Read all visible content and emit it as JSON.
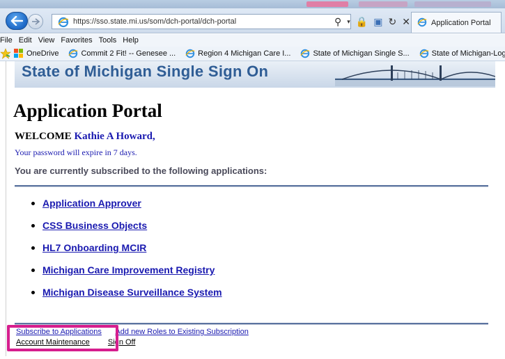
{
  "browser": {
    "url": "https://sso.state.mi.us/som/dch-portal/dch-portal",
    "active_tab": "Application Portal",
    "menu": [
      "File",
      "Edit",
      "View",
      "Favorites",
      "Tools",
      "Help"
    ],
    "favorites": [
      {
        "label": "OneDrive",
        "icon": "onedrive-icon"
      },
      {
        "label": "Commit 2 Fit! -- Genesee ...",
        "icon": "ie-icon"
      },
      {
        "label": "Region 4 Michigan Care I...",
        "icon": "ie-icon"
      },
      {
        "label": "State of Michigan Single S...",
        "icon": "ie-icon"
      },
      {
        "label": "State of Michigan-Login",
        "icon": "ie-icon"
      }
    ]
  },
  "banner": {
    "title": "State of Michigan Single Sign On"
  },
  "portal": {
    "title": "Application Portal",
    "welcome_label": "WELCOME",
    "user_name": "Kathie A Howard,",
    "password_notice": "Your password will expire in 7 days.",
    "subscribed_heading": "You are currently subscribed to the following applications:",
    "applications": [
      "Application Approver",
      "CSS Business Objects",
      "HL7 Onboarding MCIR",
      "Michigan Care Improvement Registry",
      "Michigan Disease Surveillance System"
    ]
  },
  "footer": {
    "subscribe": "Subscribe to Applications",
    "add_roles": "Add new Roles to Existing Subscription",
    "account_maintenance": "Account Maintenance",
    "sign_off": "Sign Off"
  },
  "colors": {
    "link": "#1a1ab0",
    "rule": "#5c74a0",
    "highlight": "#d61e8e",
    "banner_text": "#2f5d95"
  }
}
